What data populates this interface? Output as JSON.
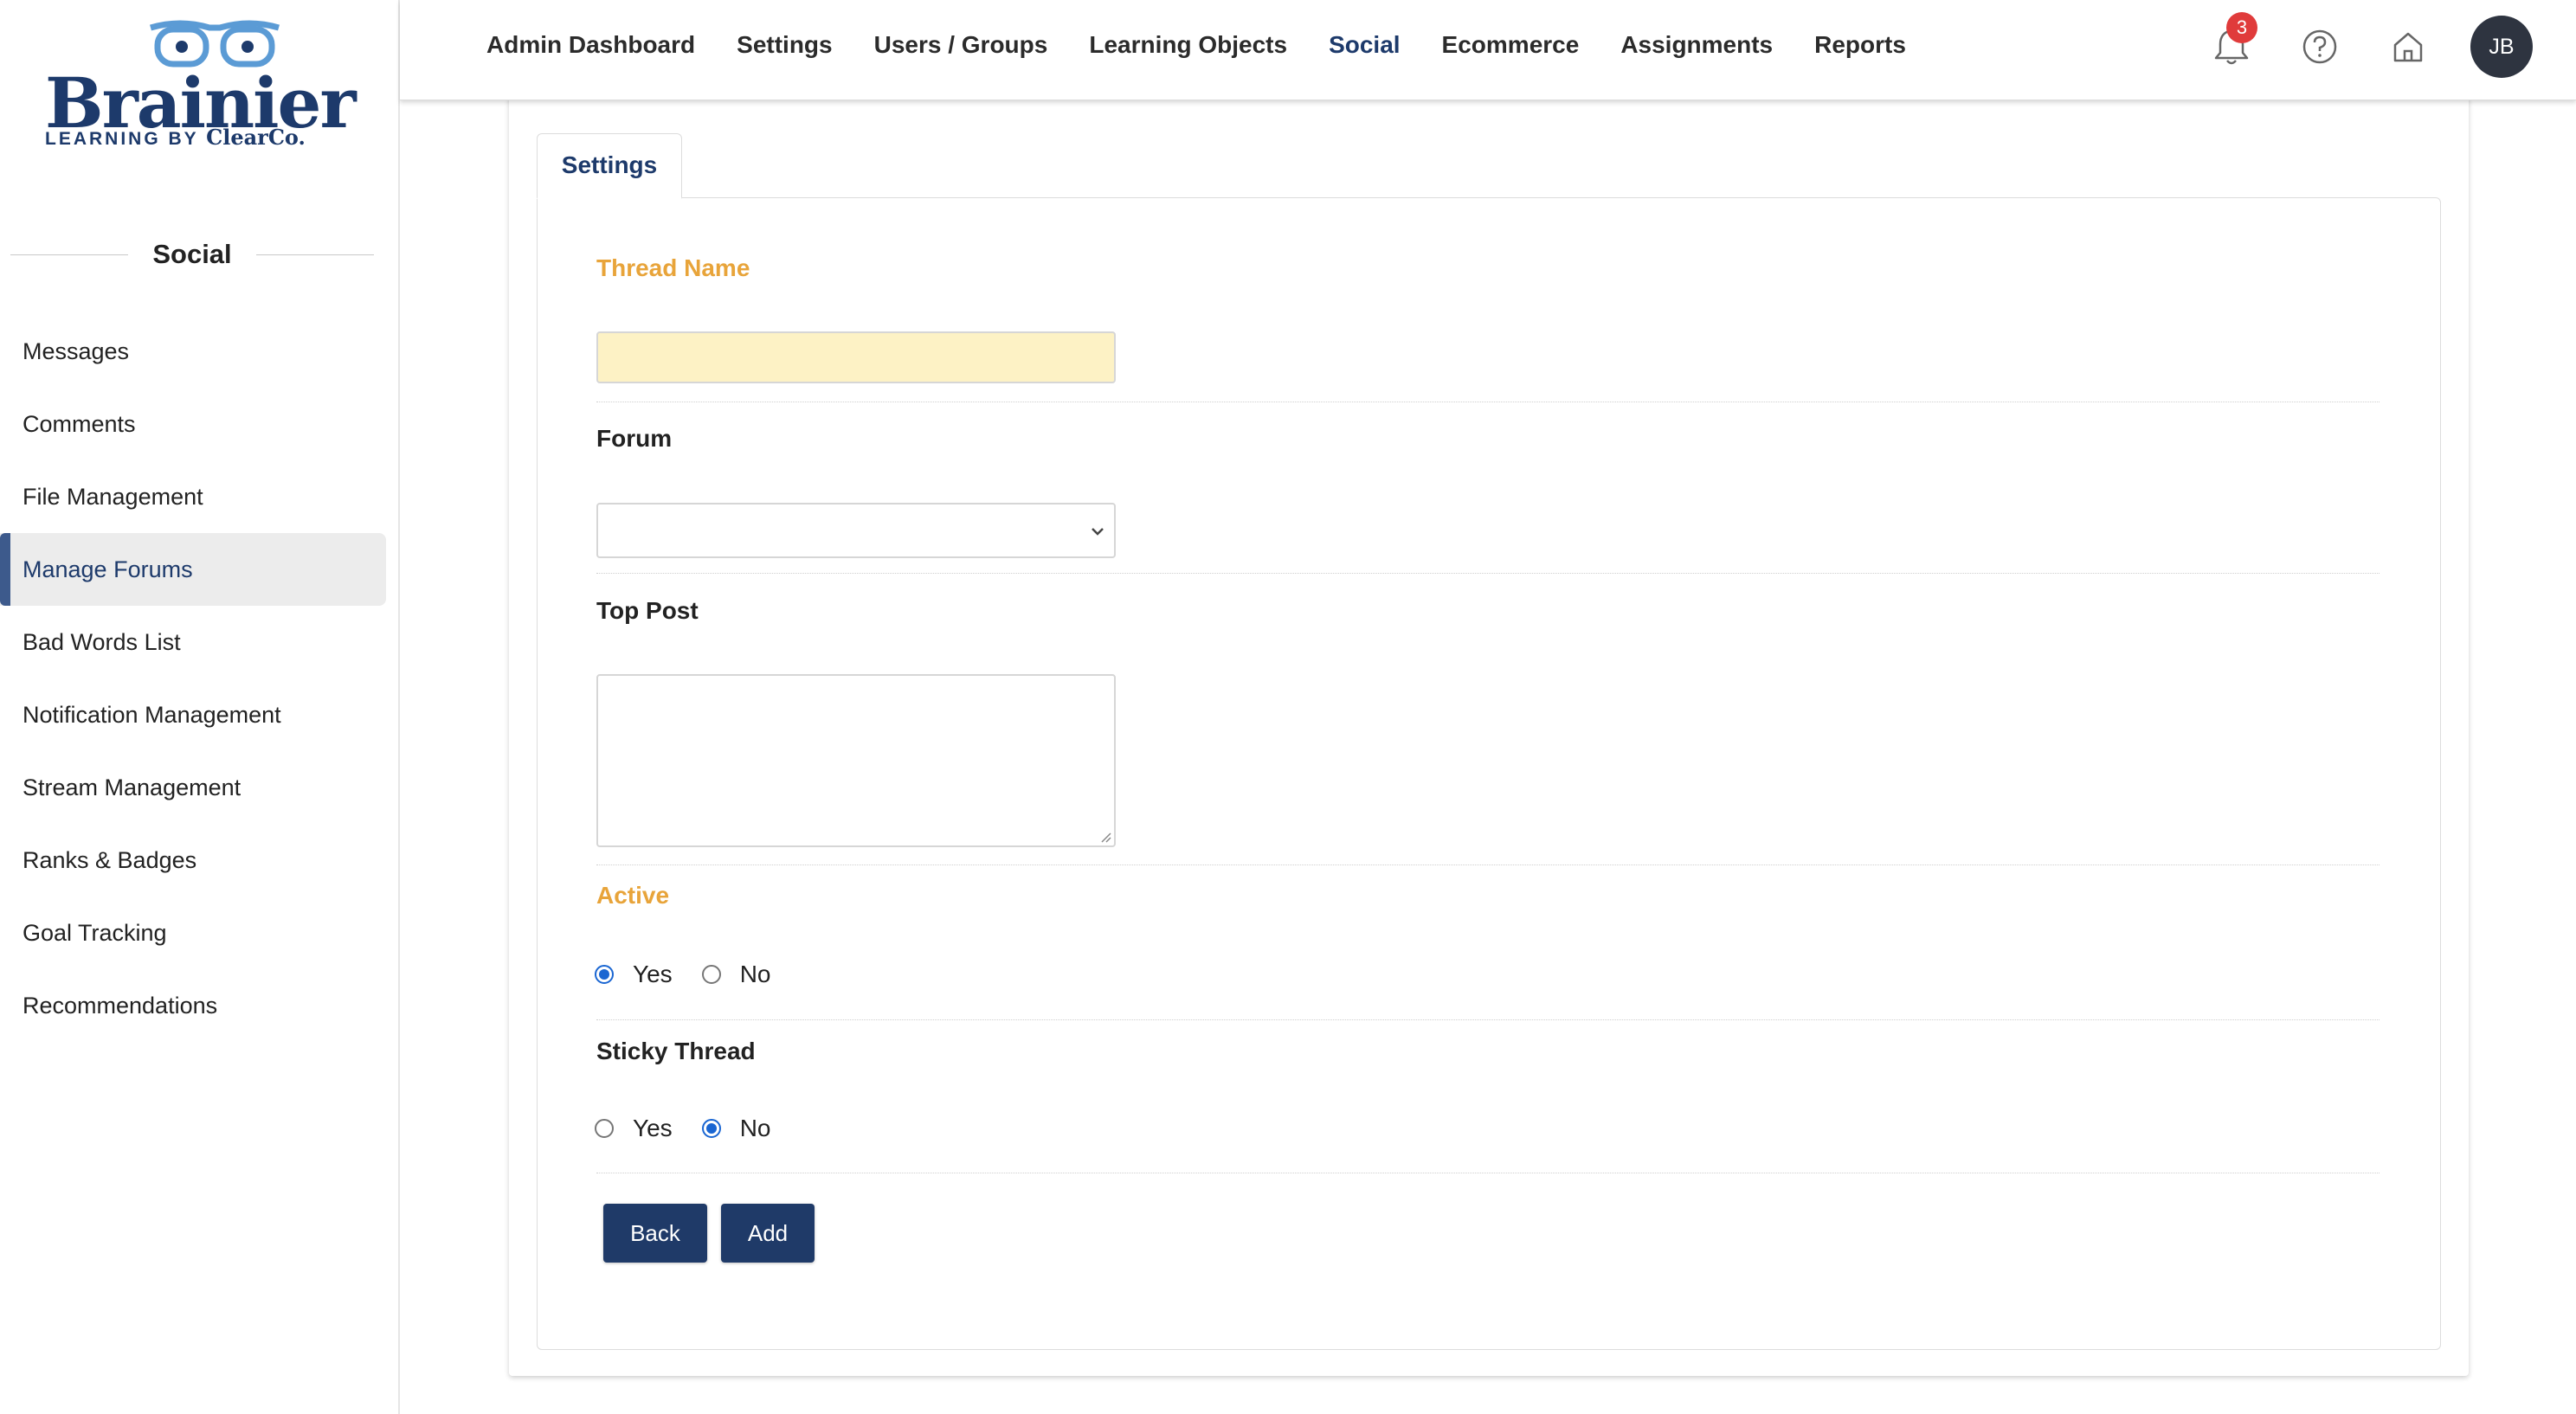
{
  "brand": {
    "logo_word": "Brainier",
    "logo_tag_prefix": "LEARNING BY",
    "logo_tag_brand": "ClearCo.",
    "color": "#1d3a6b"
  },
  "sidebar": {
    "heading": "Social",
    "items": [
      {
        "label": "Messages",
        "active": false
      },
      {
        "label": "Comments",
        "active": false
      },
      {
        "label": "File Management",
        "active": false
      },
      {
        "label": "Manage Forums",
        "active": true
      },
      {
        "label": "Bad Words List",
        "active": false
      },
      {
        "label": "Notification Management",
        "active": false
      },
      {
        "label": "Stream Management",
        "active": false
      },
      {
        "label": "Ranks & Badges",
        "active": false
      },
      {
        "label": "Goal Tracking",
        "active": false
      },
      {
        "label": "Recommendations",
        "active": false
      }
    ]
  },
  "topnav": {
    "items": [
      {
        "label": "Admin Dashboard",
        "active": false
      },
      {
        "label": "Settings",
        "active": false
      },
      {
        "label": "Users / Groups",
        "active": false
      },
      {
        "label": "Learning Objects",
        "active": false
      },
      {
        "label": "Social",
        "active": true
      },
      {
        "label": "Ecommerce",
        "active": false
      },
      {
        "label": "Assignments",
        "active": false
      },
      {
        "label": "Reports",
        "active": false
      }
    ],
    "notification_count": "3",
    "icons": [
      "bell-icon",
      "help-icon",
      "home-icon"
    ],
    "avatar_initials": "JB"
  },
  "form": {
    "tab_label": "Settings",
    "thread_name": {
      "label": "Thread Name",
      "value": "",
      "required": true
    },
    "forum": {
      "label": "Forum",
      "selected": ""
    },
    "top_post": {
      "label": "Top Post",
      "value": ""
    },
    "active": {
      "label": "Active",
      "options": [
        "Yes",
        "No"
      ],
      "selected": "Yes",
      "required": true
    },
    "sticky": {
      "label": "Sticky Thread",
      "options": [
        "Yes",
        "No"
      ],
      "selected": "No"
    },
    "buttons": {
      "back": "Back",
      "add": "Add"
    }
  },
  "colors": {
    "required_label": "#e8a43a",
    "button_bg": "#1f3a68",
    "input_highlight": "#fdf2c5",
    "badge": "#e03b3b"
  }
}
